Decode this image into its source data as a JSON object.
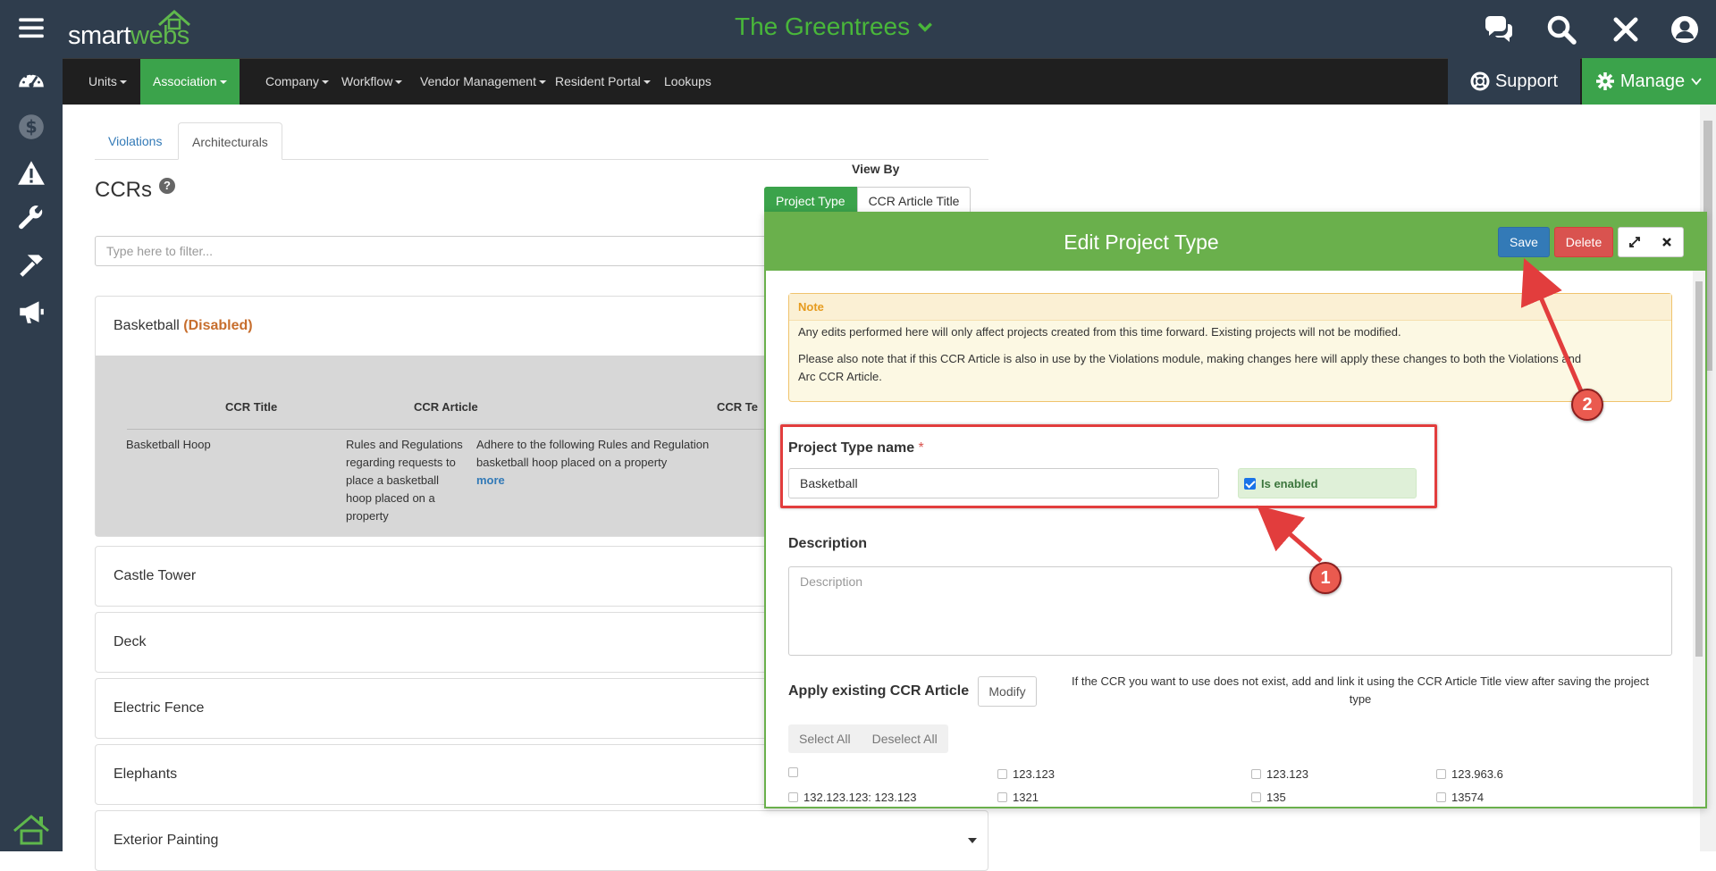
{
  "header": {
    "logo_text_a": "smart",
    "logo_text_b": "webs",
    "tenant_name": "The Greentrees",
    "icons": [
      "chat-icon",
      "search-icon",
      "close-icon",
      "user-icon"
    ]
  },
  "rail": {
    "icons": [
      "menu-icon",
      "dashboard-icon",
      "dollar-icon",
      "warning-icon",
      "wrench-icon",
      "hammer-icon",
      "megaphone-icon",
      "logo-house-icon"
    ]
  },
  "menu": {
    "items": [
      {
        "label": "Units",
        "dropdown": true
      },
      {
        "label": "Association",
        "dropdown": true,
        "active": true
      },
      {
        "label": "Company",
        "dropdown": true
      },
      {
        "label": "Workflow",
        "dropdown": true
      },
      {
        "label": "Vendor Management",
        "dropdown": true
      },
      {
        "label": "Resident Portal",
        "dropdown": true
      },
      {
        "label": "Lookups",
        "dropdown": false
      }
    ],
    "support_label": "Support",
    "manage_label": "Manage"
  },
  "tabs": {
    "violations": "Violations",
    "architecturals": "Architecturals"
  },
  "page": {
    "title": "CCRs",
    "help": "?",
    "view_by_label": "View By",
    "view_by_options": [
      "Project Type",
      "CCR Article Title"
    ],
    "filter_placeholder": "Type here to filter..."
  },
  "panels": {
    "basketball": {
      "name": "Basketball",
      "disabled_tag": "(Disabled)",
      "columns": [
        "CCR Title",
        "CCR Article",
        "CCR Te"
      ],
      "row": {
        "title": "Basketball Hoop",
        "article_lines": [
          "Rules and Regulations",
          "regarding requests to",
          "place a basketball",
          "hoop placed on a",
          "property"
        ],
        "text_lines": [
          "Adhere to the following Rules and Regulation",
          "basketball hoop placed on a property"
        ],
        "more": "more"
      }
    },
    "others": [
      "Castle Tower",
      "Deck",
      "Electric Fence",
      "Elephants",
      "Exterior Painting"
    ]
  },
  "modal": {
    "title": "Edit Project Type",
    "save": "Save",
    "delete": "Delete",
    "note_title": "Note",
    "note_p1": "Any edits performed here will only affect projects created from this time forward. Existing projects will not be modified.",
    "note_p2_line1": "Please also note that if this CCR Article is also in use by the Violations module, making changes here will apply these changes to both the Violations and",
    "note_p2_line2": "Arc CCR Article.",
    "name_label": "Project Type name",
    "required_mark": "*",
    "name_value": "Basketball",
    "enabled_label": "Is enabled",
    "enabled": true,
    "desc_label": "Description",
    "desc_placeholder": "Description",
    "apply_label": "Apply existing CCR Article",
    "modify": "Modify",
    "hint_line1": "If the CCR you want to use does not exist, add and link it using the CCR Article Title view after saving the project",
    "hint_line2": "type",
    "select_all": "Select All",
    "deselect_all": "Deselect All",
    "ccr_items": [
      "",
      "123.123",
      "123.123",
      "123.963.6",
      "132.123.123: 123.123",
      "1321",
      "135",
      "13574"
    ]
  },
  "annotations": {
    "badge1": "1",
    "badge2": "2"
  },
  "colors": {
    "brand_green": "#3ba34b",
    "header_bg": "#2f3d4d",
    "modal_header": "#6ab04c",
    "save_blue": "#337ab7",
    "delete_red": "#d9534f",
    "annotation_red": "#e23d3d"
  }
}
